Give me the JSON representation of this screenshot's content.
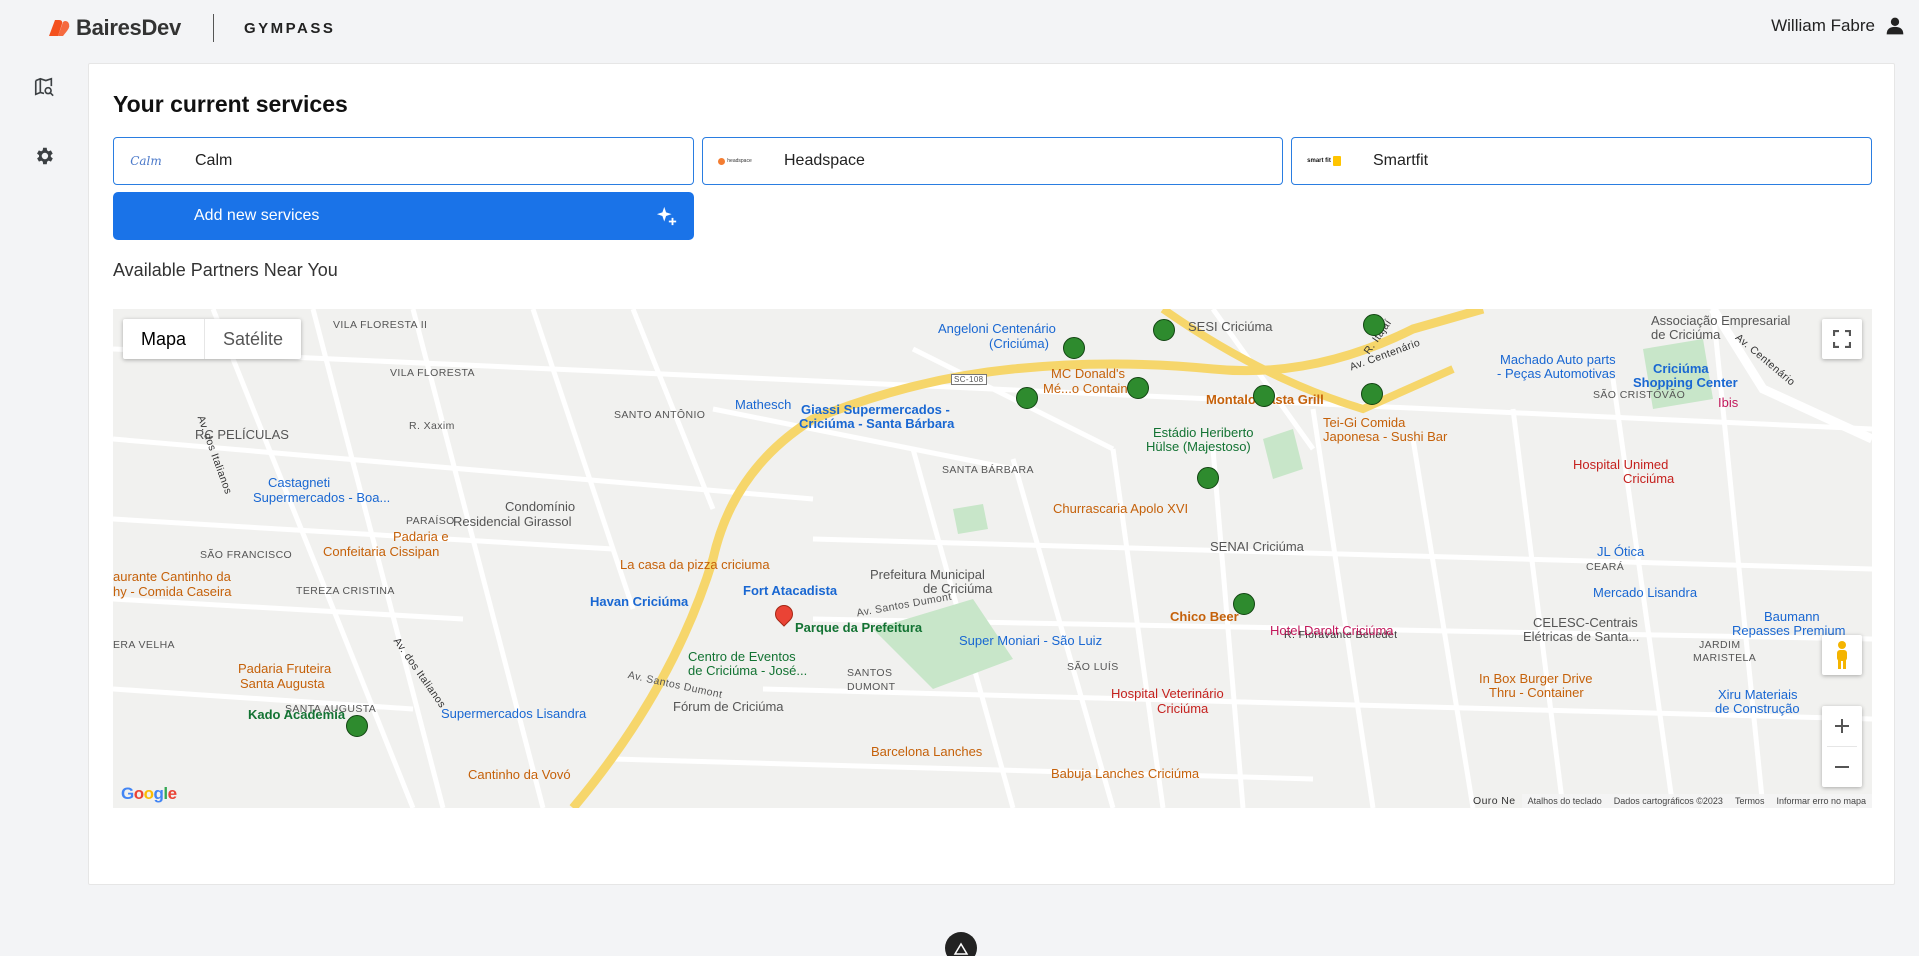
{
  "header": {
    "brand_name": "BairesDev",
    "partner_name": "GYMPASS",
    "user_name": "William Fabre",
    "brand_color": "#f4511e"
  },
  "sidebar": {
    "items": [
      {
        "icon": "map-search-icon"
      },
      {
        "icon": "gear-icon"
      }
    ]
  },
  "main": {
    "title": "Your current services",
    "services": [
      {
        "label": "Calm",
        "logo_text": "Calm"
      },
      {
        "label": "Headspace",
        "logo_text": "headspace"
      },
      {
        "label": "Smartfit",
        "logo_text": "smart fit"
      }
    ],
    "add_button_label": "Add new services",
    "partners_heading": "Available Partners Near You"
  },
  "map": {
    "type_options": [
      "Mapa",
      "Satélite"
    ],
    "selected_type": "Mapa",
    "google_logo": "Google",
    "attribution": [
      "Atalhos do teclado",
      "Dados cartográficos ©2023",
      "Termos",
      "Informar erro no mapa"
    ],
    "labels": {
      "vila_floresta_ii": "VILA FLORESTA II",
      "vila_floresta": "VILA FLORESTA",
      "santo_antonio": "SANTO ANTÔNIO",
      "rc_peliculas": "RC PELÍCULAS",
      "castagneti": "Castagneti",
      "castagneti2": "Supermercados - Boa...",
      "condominio": "Condomínio",
      "condominio2": "Residencial Girassol",
      "padaria_cissipan": "Padaria e",
      "padaria_cissipan2": "Confeitaria Cissipan",
      "paraiso": "PARAÍSO",
      "cantinho_da": "aurante Cantinho da",
      "cantinho_da2": "hy - Comida Caseira",
      "sao_francisco": "SÃO FRANCISCO",
      "tereza_cristina": "TEREZA CRISTINA",
      "padaria_fruteira": "Padaria Fruteira",
      "padaria_fruteira2": "Santa Augusta",
      "kado_academia": "Kado Academia",
      "vera_velha": "ERA VELHA",
      "santa_augusta": "SANTA AUGUSTA",
      "cantinho_vovo": "Cantinho da Vovó",
      "supermercados_lisandra": "Supermercados Lisandra",
      "forum": "Fórum de Criciúma",
      "santos_dumont": "SANTOS",
      "santos_dumont2": "DUMONT",
      "av_santos_dumont": "Av. Santos Dumont",
      "barcelona": "Barcelona Lanches",
      "sao_luis": "SÃO LUÍS",
      "babuja": "Babuja Lanches Criciúma",
      "centro_eventos": "Centro de Eventos",
      "centro_eventos2": "de Criciúma - José...",
      "parque_prefeitura": "Parque da Prefeitura",
      "havan": "Havan Criciúma",
      "fort": "Fort Atacadista",
      "la_casa": "La casa da pizza criciuma",
      "prefeitura": "Prefeitura Municipal",
      "prefeitura2": "de Criciúma",
      "super_moniari": "Super Moniari - São Luiz",
      "hospital_vet": "Hospital Veterinário",
      "hospital_vet2": "Criciúma",
      "chico_beer": "Chico Beer",
      "hotel_darolt": "Hotel Darolt Criciúma",
      "senai": "SENAI Criciúma",
      "churrascaria": "Churrascaria Apolo XVI",
      "estadio": "Estádio Heriberto",
      "estadio2": "Hülse (Majestoso)",
      "montalo": "Montalo Pasta Grill",
      "mc_donalds": "MC Donald's",
      "mathesch": "Mathesch",
      "giassi": "Giassi Supermercados -",
      "giassi2": "Criciúma - Santa Bárbara",
      "angeloni": "Angeloni Centenário",
      "angeloni2": "(Criciúma)",
      "sesi": "SESI Criciúma",
      "santa_barbara": "SANTA BÁRBARA",
      "tei_gi": "Tei-Gi Comida",
      "tei_gi2": "Japonesa - Sushi Bar",
      "associacao": "Associação Empresarial",
      "associacao2": "de Criciúma",
      "machado": "Machado Auto parts",
      "machado2": "- Peças Automotivas",
      "shopping": "Criciúma",
      "shopping2": "Shopping Center",
      "sao_cristovao": "SÃO CRISTÓVÃO",
      "ibis": "Ibis",
      "hospital_unimed": "Hospital Unimed",
      "hospital_unimed2": "Criciúma",
      "jl_otica": "JL Ótica",
      "ceara": "CEARÁ",
      "mercado_lisandra": "Mercado Lisandra",
      "baumann": "Baumann",
      "baumann2": "Repasses Premium",
      "celesc": "CELESC-Centrais",
      "celesc2": "Elétricas de Santa...",
      "jardim_maristela": "JARDIM",
      "jardim_maristela2": "MARISTELA",
      "in_box": "In Box Burger Drive",
      "in_box2": "Thru - Container",
      "xiru": "Xiru Materiais",
      "xiru2": "de Construção",
      "r_fioravante": "R. Fioravante Benedet",
      "av_centenario": "Av. Centenário",
      "sc108": "SC-108",
      "av_dos_italianos": "Av. dos Italianos",
      "r_itajai": "R. Itajaí",
      "r_xaxim": "R. Xaxim",
      "ouro_negro": "Ouro Ne",
      "mc_container": "Mé...o Container"
    }
  }
}
